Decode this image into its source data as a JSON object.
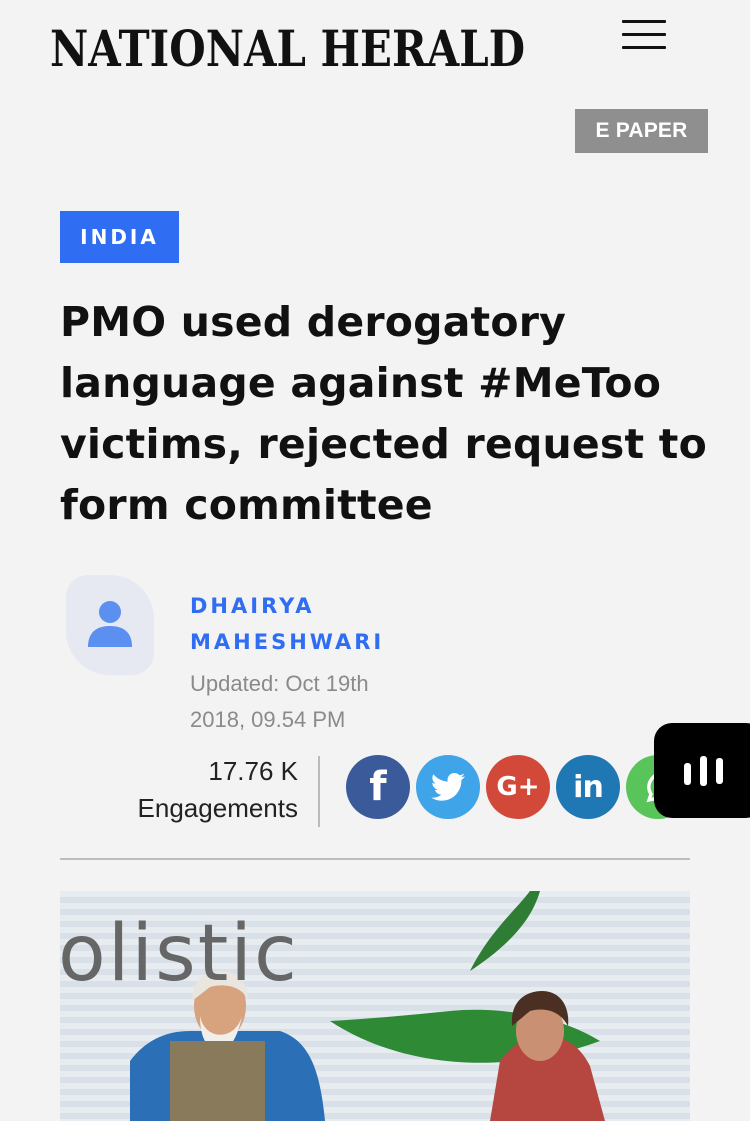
{
  "header": {
    "brand": "NATIONAL HERALD",
    "menu_icon": "hamburger-icon",
    "epaper_label": "E PAPER"
  },
  "article": {
    "category": "INDIA",
    "headline_lines": [
      "PMO used derogatory",
      "language against #MeToo",
      "victims, rejected request to",
      "form committee"
    ],
    "author_lines": [
      "DHAIRYA",
      "MAHESHWARI"
    ],
    "updated_lines": [
      "Updated: Oct 19th",
      "2018, 09.54 PM"
    ],
    "engagement_count": "17.76 K",
    "engagement_label": "Engagements",
    "hero_text": "olistic"
  },
  "share": [
    {
      "name": "facebook",
      "glyph": "f",
      "icon": "facebook-icon",
      "color": "#3b5a9a"
    },
    {
      "name": "twitter",
      "glyph": "",
      "icon": "twitter-icon",
      "color": "#3fa4e8"
    },
    {
      "name": "google-plus",
      "glyph": "G+",
      "icon": "google-plus-icon",
      "color": "#d2493a"
    },
    {
      "name": "linkedin",
      "glyph": "in",
      "icon": "linkedin-icon",
      "color": "#1f78b4"
    },
    {
      "name": "whatsapp",
      "glyph": "",
      "icon": "whatsapp-icon",
      "color": "#59c45a"
    }
  ],
  "colors": {
    "accent": "#2f6df2",
    "background": "#f3f3f3",
    "epaper_bg": "#8f8f8f"
  }
}
